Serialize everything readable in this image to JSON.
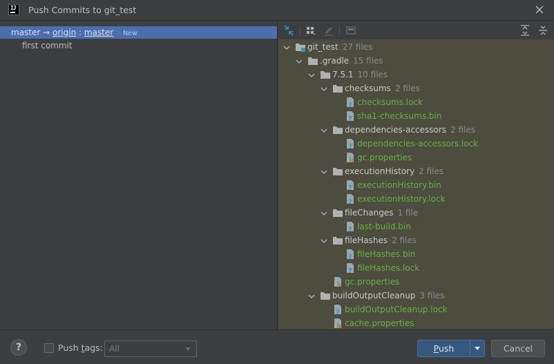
{
  "window": {
    "title": "Push Commits to git_test",
    "app_icon": "intellij-idea-icon"
  },
  "left": {
    "branch": {
      "local": "master",
      "arrow": "→",
      "remote": "origin",
      "sep": ":",
      "target": "master",
      "badge": "New"
    },
    "commits": [
      "first commit"
    ]
  },
  "toolbar": {
    "icons": [
      "collapse-toggle-icon",
      "group-by-icon",
      "edit-icon",
      "show-diff-icon",
      "expand-all-icon",
      "collapse-all-icon"
    ]
  },
  "tree": [
    {
      "name": "git_test",
      "count": "27 files",
      "kind": "root"
    },
    {
      "name": ".gradle",
      "count": "15 files",
      "kind": "dir"
    },
    {
      "name": "7.5.1",
      "count": "10 files",
      "kind": "dir"
    },
    {
      "name": "checksums",
      "count": "2 files",
      "kind": "dir"
    },
    {
      "name": "checksums.lock",
      "count": "",
      "kind": "unknown-file"
    },
    {
      "name": "sha1-checksums.bin",
      "count": "",
      "kind": "unknown-file"
    },
    {
      "name": "dependencies-accessors",
      "count": "2 files",
      "kind": "dir"
    },
    {
      "name": "dependencies-accessors.lock",
      "count": "",
      "kind": "unknown-file"
    },
    {
      "name": "gc.properties",
      "count": "",
      "kind": "properties-file"
    },
    {
      "name": "executionHistory",
      "count": "2 files",
      "kind": "dir"
    },
    {
      "name": "executionHistory.bin",
      "count": "",
      "kind": "unknown-file"
    },
    {
      "name": "executionHistory.lock",
      "count": "",
      "kind": "unknown-file"
    },
    {
      "name": "fileChanges",
      "count": "1 file",
      "kind": "dir"
    },
    {
      "name": "last-build.bin",
      "count": "",
      "kind": "unknown-file"
    },
    {
      "name": "fileHashes",
      "count": "2 files",
      "kind": "dir"
    },
    {
      "name": "fileHashes.bin",
      "count": "",
      "kind": "unknown-file"
    },
    {
      "name": "fileHashes.lock",
      "count": "",
      "kind": "unknown-file"
    },
    {
      "name": "gc.properties",
      "count": "",
      "kind": "properties-file"
    },
    {
      "name": "buildOutputCleanup",
      "count": "3 files",
      "kind": "dir"
    },
    {
      "name": "buildOutputCleanup.lock",
      "count": "",
      "kind": "unknown-file"
    },
    {
      "name": "cache.properties",
      "count": "",
      "kind": "properties-file"
    }
  ],
  "bottom": {
    "help": "?",
    "push_tags_label": "Push tags:",
    "push_tags_mnemonic": "t",
    "tags_value": "All",
    "push_label": "Push",
    "cancel_label": "Cancel"
  },
  "colors": {
    "background": "#3c3f41",
    "selection": "#4b6eaf",
    "tree_bg": "#4e4b3f",
    "added_file": "#62b543",
    "primary_button": "#365880"
  }
}
